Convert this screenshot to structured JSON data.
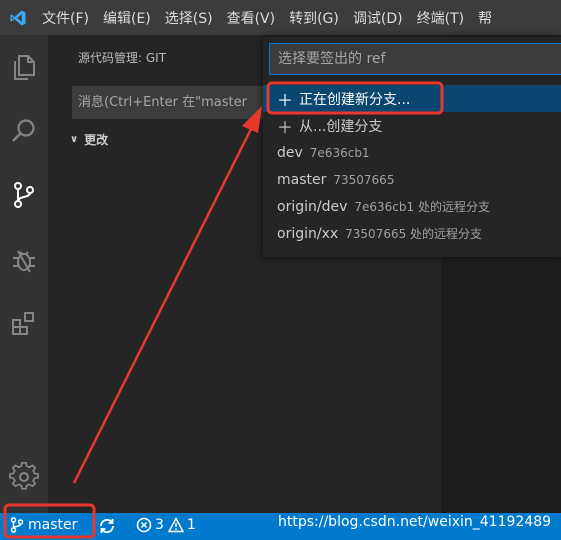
{
  "menubar": {
    "logo_icon": "vscode-logo-icon",
    "items": [
      "文件(F)",
      "编辑(E)",
      "选择(S)",
      "查看(V)",
      "转到(G)",
      "调试(D)",
      "终端(T)",
      "帮"
    ]
  },
  "activitybar": {
    "icons": [
      "explorer-icon",
      "search-icon",
      "source-control-icon",
      "debug-icon",
      "extensions-icon",
      "settings-gear-icon"
    ]
  },
  "sidebar": {
    "title": "源代码管理: GIT",
    "commit_message_placeholder": "消息(Ctrl+Enter 在\"master",
    "changes_label": "更改"
  },
  "quickpick": {
    "placeholder": "选择要签出的 ref",
    "items": [
      {
        "label": "正在创建新分支...",
        "desc": "",
        "plus": "＋",
        "selected": true
      },
      {
        "label": "从...创建分支",
        "desc": "",
        "plus": "＋",
        "selected": false
      },
      {
        "label": "dev",
        "desc": "7e636cb1",
        "plus": "",
        "selected": false
      },
      {
        "label": "master",
        "desc": "73507665",
        "plus": "",
        "selected": false
      },
      {
        "label": "origin/dev",
        "desc": "7e636cb1 处的远程分支",
        "plus": "",
        "selected": false
      },
      {
        "label": "origin/xx",
        "desc": "73507665 处的远程分支",
        "plus": "",
        "selected": false
      }
    ]
  },
  "statusbar": {
    "branch": "master",
    "errors": "3",
    "warnings": "1",
    "watermark": "https://blog.csdn.net/weixin_41192489"
  },
  "colors": {
    "accent": "#007acc",
    "annotation": "#e8382c",
    "selection": "#094771"
  }
}
